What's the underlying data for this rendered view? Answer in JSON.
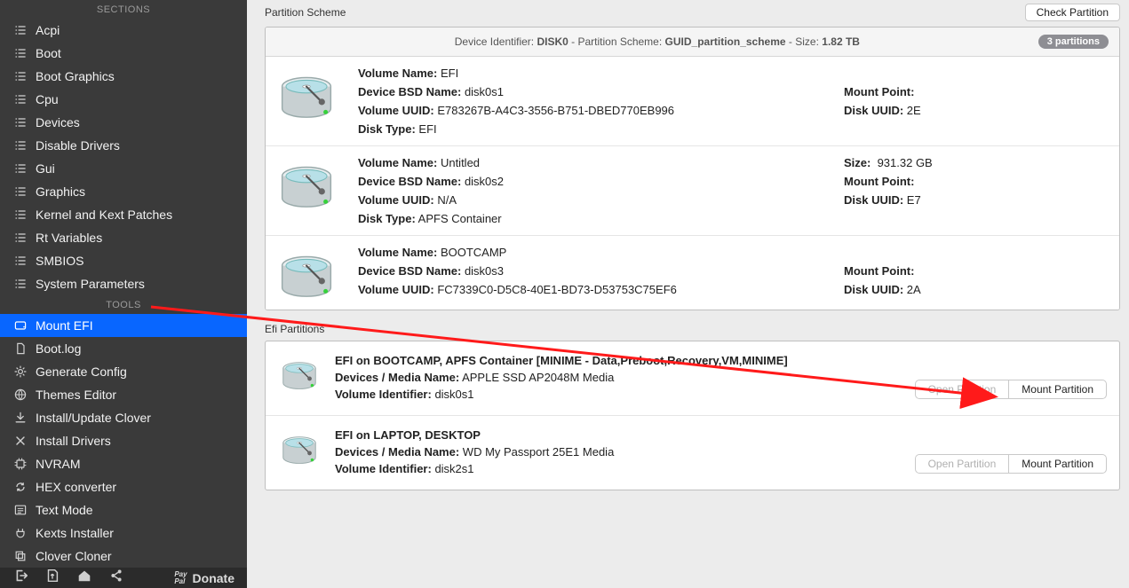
{
  "sidebar": {
    "sections_label": "SECTIONS",
    "tools_label": "TOOLS",
    "sections": [
      {
        "label": "Acpi",
        "icon": "list"
      },
      {
        "label": "Boot",
        "icon": "list"
      },
      {
        "label": "Boot Graphics",
        "icon": "list"
      },
      {
        "label": "Cpu",
        "icon": "list"
      },
      {
        "label": "Devices",
        "icon": "list"
      },
      {
        "label": "Disable Drivers",
        "icon": "list"
      },
      {
        "label": "Gui",
        "icon": "list"
      },
      {
        "label": "Graphics",
        "icon": "list"
      },
      {
        "label": "Kernel and Kext Patches",
        "icon": "list"
      },
      {
        "label": "Rt Variables",
        "icon": "list"
      },
      {
        "label": "SMBIOS",
        "icon": "list"
      },
      {
        "label": "System Parameters",
        "icon": "list"
      }
    ],
    "tools": [
      {
        "label": "Mount EFI",
        "icon": "drive",
        "selected": true
      },
      {
        "label": "Boot.log",
        "icon": "doc"
      },
      {
        "label": "Generate Config",
        "icon": "gear"
      },
      {
        "label": "Themes Editor",
        "icon": "globe"
      },
      {
        "label": "Install/Update Clover",
        "icon": "download"
      },
      {
        "label": "Install Drivers",
        "icon": "tools"
      },
      {
        "label": "NVRAM",
        "icon": "chip"
      },
      {
        "label": "HEX converter",
        "icon": "refresh"
      },
      {
        "label": "Text Mode",
        "icon": "text"
      },
      {
        "label": "Kexts Installer",
        "icon": "plug"
      },
      {
        "label": "Clover Cloner",
        "icon": "copy"
      }
    ]
  },
  "bottom": {
    "donate_label": "Donate"
  },
  "top": {
    "title": "Partition Scheme",
    "check_button": "Check Partition"
  },
  "scheme": {
    "header_prefix": "Device Identifier: ",
    "device_id": "DISK0",
    "header_mid1": " - Partition Scheme: ",
    "scheme_name": "GUID_partition_scheme",
    "header_mid2": " - Size: ",
    "size": "1.82 TB",
    "pill": "3 partitions",
    "labels": {
      "volume_name": "Volume Name:",
      "bsd_name": "Device BSD Name:",
      "volume_uuid": "Volume UUID:",
      "disk_type": "Disk Type:",
      "mount_point": "Mount Point:",
      "disk_uuid": "Disk UUID:",
      "size": "Size:"
    },
    "partitions": [
      {
        "volume_name": "EFI",
        "bsd_name": "disk0s1",
        "volume_uuid": "E783267B-A4C3-3556-B751-DBED770EB996",
        "disk_type": "EFI",
        "mount_point": "",
        "disk_uuid_vis": "2E",
        "size_vis": ""
      },
      {
        "volume_name": "Untitled",
        "bsd_name": "disk0s2",
        "volume_uuid": "N/A",
        "disk_type": "APFS Container",
        "mount_point": "",
        "disk_uuid_vis": "E7",
        "size_vis": "931.32 GB"
      },
      {
        "volume_name": "BOOTCAMP",
        "bsd_name": "disk0s3",
        "volume_uuid": "FC7339C0-D5C8-40E1-BD73-D53753C75EF6",
        "disk_type": "",
        "mount_point": "",
        "disk_uuid_vis": "2A",
        "size_vis": ""
      }
    ]
  },
  "efi_section_label": "Efi Partitions",
  "efi": {
    "labels": {
      "devices_media": "Devices / Media Name:",
      "volume_identifier": "Volume Identifier:",
      "open_partition": "Open Partition",
      "mount_partition": "Mount Partition"
    },
    "rows": [
      {
        "title": "EFI on BOOTCAMP, APFS Container [MINIME - Data,Preboot,Recovery,VM,MINIME]",
        "media": "APPLE SSD AP2048M Media",
        "vol_id": "disk0s1"
      },
      {
        "title": "EFI on LAPTOP, DESKTOP",
        "media": "WD My Passport 25E1 Media",
        "vol_id": "disk2s1"
      }
    ]
  }
}
